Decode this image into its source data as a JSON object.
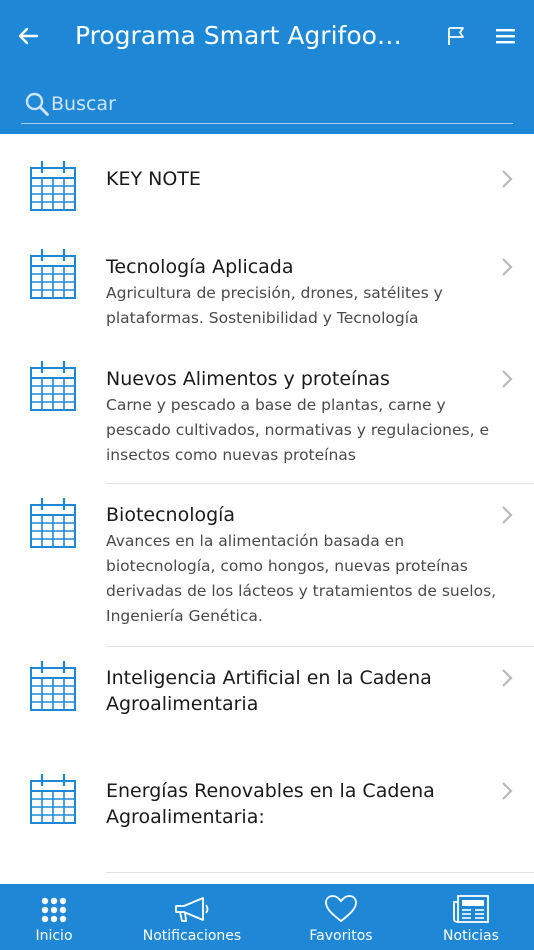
{
  "header": {
    "title": "Programa Smart Agrifood ...",
    "back_icon": "arrow-left-icon",
    "flag_icon": "flag-icon",
    "menu_icon": "hamburger-menu-icon",
    "background": "#1f88d6"
  },
  "search": {
    "placeholder": "Buscar"
  },
  "items": [
    {
      "title": "KEY NOTE",
      "description": ""
    },
    {
      "title": "Tecnología Aplicada",
      "description": " Agricultura de precisión, drones, satélites y plataformas. Sostenibilidad y Tecnología"
    },
    {
      "title": "Nuevos Alimentos y proteínas",
      "description": " Carne y pescado a base de plantas, carne y pescado cultivados, normativas y regulaciones, e insectos como nuevas proteínas"
    },
    {
      "title": "Biotecnología",
      "description": " Avances en la alimentación basada en biotecnología, como hongos, nuevas proteínas derivadas de los lácteos y tratamientos de suelos, Ingeniería Genética."
    },
    {
      "title": "Inteligencia Artificial en la Cadena Agroalimentaria",
      "description": ""
    },
    {
      "title": "Energías Renovables en la Cadena Agroalimentaria:",
      "description": ""
    }
  ],
  "tabs": [
    {
      "label": "Inicio",
      "icon": "grid-dots-icon"
    },
    {
      "label": "Notificaciones",
      "icon": "megaphone-icon"
    },
    {
      "label": "Favoritos",
      "icon": "heart-icon"
    },
    {
      "label": "Noticias",
      "icon": "newspaper-icon"
    }
  ],
  "colors": {
    "accent": "#1f88d6",
    "icon": "#1f88d6"
  }
}
